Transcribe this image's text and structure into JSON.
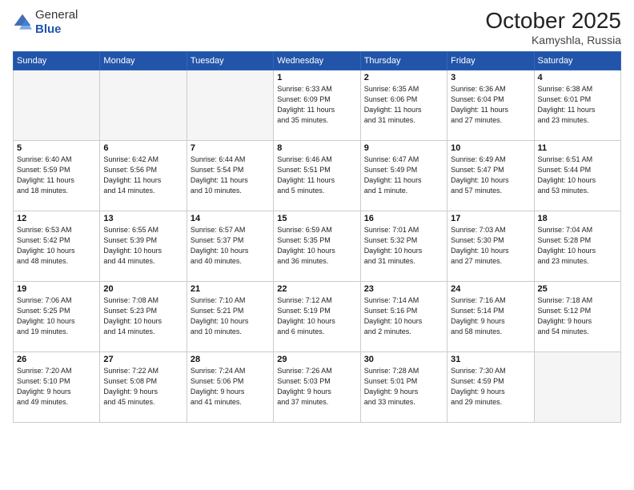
{
  "header": {
    "logo_general": "General",
    "logo_blue": "Blue",
    "month_title": "October 2025",
    "location": "Kamyshla, Russia"
  },
  "weekdays": [
    "Sunday",
    "Monday",
    "Tuesday",
    "Wednesday",
    "Thursday",
    "Friday",
    "Saturday"
  ],
  "weeks": [
    [
      {
        "day": "",
        "empty": true
      },
      {
        "day": "",
        "empty": true
      },
      {
        "day": "",
        "empty": true
      },
      {
        "day": "1",
        "lines": [
          "Sunrise: 6:33 AM",
          "Sunset: 6:09 PM",
          "Daylight: 11 hours",
          "and 35 minutes."
        ]
      },
      {
        "day": "2",
        "lines": [
          "Sunrise: 6:35 AM",
          "Sunset: 6:06 PM",
          "Daylight: 11 hours",
          "and 31 minutes."
        ]
      },
      {
        "day": "3",
        "lines": [
          "Sunrise: 6:36 AM",
          "Sunset: 6:04 PM",
          "Daylight: 11 hours",
          "and 27 minutes."
        ]
      },
      {
        "day": "4",
        "lines": [
          "Sunrise: 6:38 AM",
          "Sunset: 6:01 PM",
          "Daylight: 11 hours",
          "and 23 minutes."
        ]
      }
    ],
    [
      {
        "day": "5",
        "lines": [
          "Sunrise: 6:40 AM",
          "Sunset: 5:59 PM",
          "Daylight: 11 hours",
          "and 18 minutes."
        ]
      },
      {
        "day": "6",
        "lines": [
          "Sunrise: 6:42 AM",
          "Sunset: 5:56 PM",
          "Daylight: 11 hours",
          "and 14 minutes."
        ]
      },
      {
        "day": "7",
        "lines": [
          "Sunrise: 6:44 AM",
          "Sunset: 5:54 PM",
          "Daylight: 11 hours",
          "and 10 minutes."
        ]
      },
      {
        "day": "8",
        "lines": [
          "Sunrise: 6:46 AM",
          "Sunset: 5:51 PM",
          "Daylight: 11 hours",
          "and 5 minutes."
        ]
      },
      {
        "day": "9",
        "lines": [
          "Sunrise: 6:47 AM",
          "Sunset: 5:49 PM",
          "Daylight: 11 hours",
          "and 1 minute."
        ]
      },
      {
        "day": "10",
        "lines": [
          "Sunrise: 6:49 AM",
          "Sunset: 5:47 PM",
          "Daylight: 10 hours",
          "and 57 minutes."
        ]
      },
      {
        "day": "11",
        "lines": [
          "Sunrise: 6:51 AM",
          "Sunset: 5:44 PM",
          "Daylight: 10 hours",
          "and 53 minutes."
        ]
      }
    ],
    [
      {
        "day": "12",
        "lines": [
          "Sunrise: 6:53 AM",
          "Sunset: 5:42 PM",
          "Daylight: 10 hours",
          "and 48 minutes."
        ]
      },
      {
        "day": "13",
        "lines": [
          "Sunrise: 6:55 AM",
          "Sunset: 5:39 PM",
          "Daylight: 10 hours",
          "and 44 minutes."
        ]
      },
      {
        "day": "14",
        "lines": [
          "Sunrise: 6:57 AM",
          "Sunset: 5:37 PM",
          "Daylight: 10 hours",
          "and 40 minutes."
        ]
      },
      {
        "day": "15",
        "lines": [
          "Sunrise: 6:59 AM",
          "Sunset: 5:35 PM",
          "Daylight: 10 hours",
          "and 36 minutes."
        ]
      },
      {
        "day": "16",
        "lines": [
          "Sunrise: 7:01 AM",
          "Sunset: 5:32 PM",
          "Daylight: 10 hours",
          "and 31 minutes."
        ]
      },
      {
        "day": "17",
        "lines": [
          "Sunrise: 7:03 AM",
          "Sunset: 5:30 PM",
          "Daylight: 10 hours",
          "and 27 minutes."
        ]
      },
      {
        "day": "18",
        "lines": [
          "Sunrise: 7:04 AM",
          "Sunset: 5:28 PM",
          "Daylight: 10 hours",
          "and 23 minutes."
        ]
      }
    ],
    [
      {
        "day": "19",
        "lines": [
          "Sunrise: 7:06 AM",
          "Sunset: 5:25 PM",
          "Daylight: 10 hours",
          "and 19 minutes."
        ]
      },
      {
        "day": "20",
        "lines": [
          "Sunrise: 7:08 AM",
          "Sunset: 5:23 PM",
          "Daylight: 10 hours",
          "and 14 minutes."
        ]
      },
      {
        "day": "21",
        "lines": [
          "Sunrise: 7:10 AM",
          "Sunset: 5:21 PM",
          "Daylight: 10 hours",
          "and 10 minutes."
        ]
      },
      {
        "day": "22",
        "lines": [
          "Sunrise: 7:12 AM",
          "Sunset: 5:19 PM",
          "Daylight: 10 hours",
          "and 6 minutes."
        ]
      },
      {
        "day": "23",
        "lines": [
          "Sunrise: 7:14 AM",
          "Sunset: 5:16 PM",
          "Daylight: 10 hours",
          "and 2 minutes."
        ]
      },
      {
        "day": "24",
        "lines": [
          "Sunrise: 7:16 AM",
          "Sunset: 5:14 PM",
          "Daylight: 9 hours",
          "and 58 minutes."
        ]
      },
      {
        "day": "25",
        "lines": [
          "Sunrise: 7:18 AM",
          "Sunset: 5:12 PM",
          "Daylight: 9 hours",
          "and 54 minutes."
        ]
      }
    ],
    [
      {
        "day": "26",
        "lines": [
          "Sunrise: 7:20 AM",
          "Sunset: 5:10 PM",
          "Daylight: 9 hours",
          "and 49 minutes."
        ]
      },
      {
        "day": "27",
        "lines": [
          "Sunrise: 7:22 AM",
          "Sunset: 5:08 PM",
          "Daylight: 9 hours",
          "and 45 minutes."
        ]
      },
      {
        "day": "28",
        "lines": [
          "Sunrise: 7:24 AM",
          "Sunset: 5:06 PM",
          "Daylight: 9 hours",
          "and 41 minutes."
        ]
      },
      {
        "day": "29",
        "lines": [
          "Sunrise: 7:26 AM",
          "Sunset: 5:03 PM",
          "Daylight: 9 hours",
          "and 37 minutes."
        ]
      },
      {
        "day": "30",
        "lines": [
          "Sunrise: 7:28 AM",
          "Sunset: 5:01 PM",
          "Daylight: 9 hours",
          "and 33 minutes."
        ]
      },
      {
        "day": "31",
        "lines": [
          "Sunrise: 7:30 AM",
          "Sunset: 4:59 PM",
          "Daylight: 9 hours",
          "and 29 minutes."
        ]
      },
      {
        "day": "",
        "empty": true
      }
    ]
  ]
}
